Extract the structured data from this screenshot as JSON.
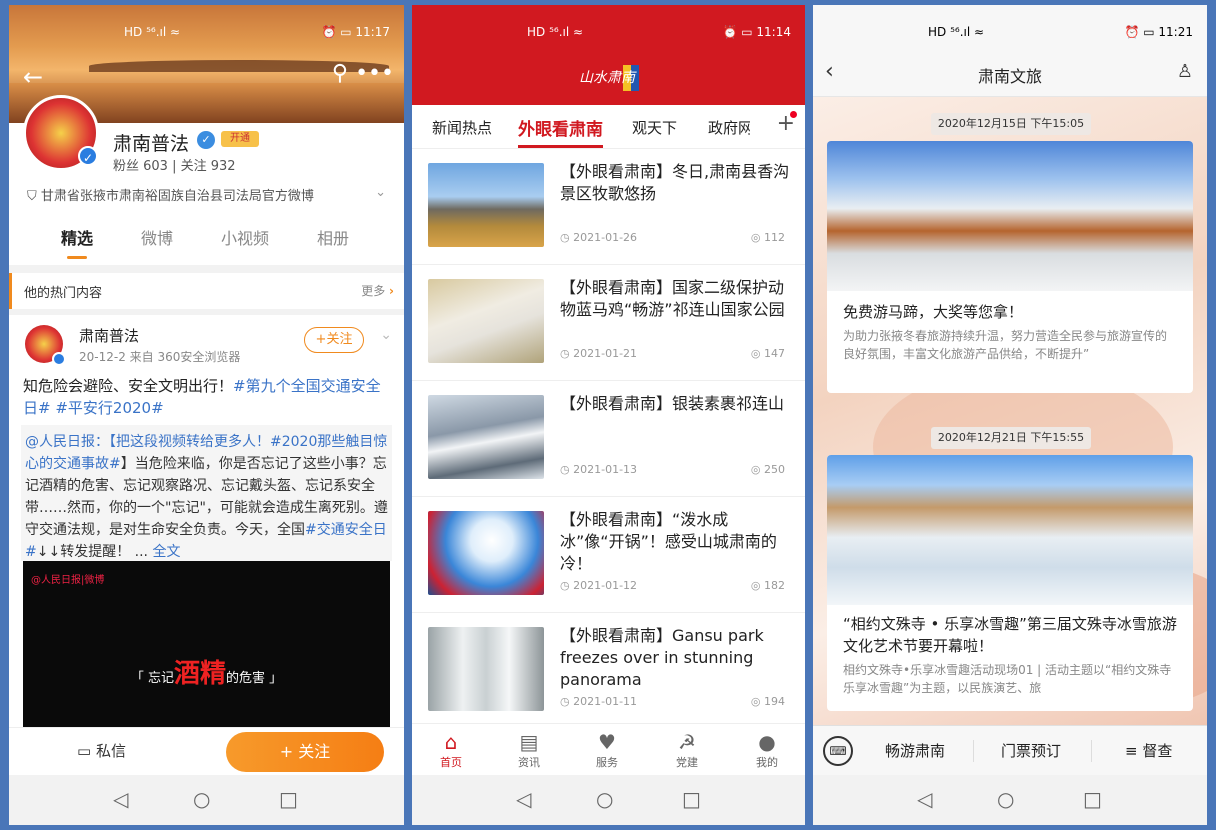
{
  "left_phone": {
    "status": {
      "signal": "HD ⁵⁶.ıl ≈",
      "right": "⏰ ▭ 11:17"
    },
    "profile": {
      "name": "肃南普法",
      "vip": "开通",
      "stats": "粉丝 603 | 关注 932",
      "desc": "甘肃省张掖市肃南裕固族自治县司法局官方微博"
    },
    "tabs": [
      "精选",
      "微博",
      "小视频",
      "相册"
    ],
    "hot": {
      "title": "他的热门内容",
      "more": "更多"
    },
    "post": {
      "author": "肃南普法",
      "meta": "20-12-2  来自 360安全浏览器",
      "follow": "+关注",
      "text_main": "知危险会避险、安全文明出行！",
      "text_tag": "#第九个全国交通安全日# #平安行2020#",
      "repost_prefix": "@人民日报：【把这段视频转给更多人！",
      "repost_tag1": "#2020那些触目惊心的交通事故#",
      "repost_body": "】当危险来临，你是否忘记了这些小事？忘记酒精的危害、忘记观察路况、忘记戴头盔、忘记系安全带……然而，你的一个\"忘记\"，可能就会造成生离死别。遵守交通法规，是对生命安全负责。今天，全国",
      "repost_tag2": "#交通安全日#",
      "repost_tail": "↓↓转发提醒！ ...",
      "repost_full": "全文",
      "video_logo": "@人民日报|微博",
      "video_cap_pre": "「   忘记",
      "video_cap_big": "酒精",
      "video_cap_post": "的危害   」"
    },
    "bottom": {
      "dm": "私信",
      "follow": "+ 关注"
    }
  },
  "mid_phone": {
    "status": {
      "signal": "HD ⁵⁶.ıl ≈",
      "right": "⏰ ▭ 11:14"
    },
    "logo": "山水肃南",
    "tabs": [
      "新闻热点",
      "外眼看肃南",
      "观天下",
      "政府网"
    ],
    "articles": [
      {
        "title": "【外眼看肃南】冬日,肃南县香沟景区牧歌悠扬",
        "date": "2021-01-26",
        "views": "112"
      },
      {
        "title": "【外眼看肃南】国家二级保护动物蓝马鸡“畅游”祁连山国家公园",
        "date": "2021-01-21",
        "views": "147"
      },
      {
        "title": "【外眼看肃南】银装素裹祁连山",
        "date": "2021-01-13",
        "views": "250"
      },
      {
        "title": "【外眼看肃南】“泼水成冰”像“开锅”！感受山城肃南的冷！",
        "date": "2021-01-12",
        "views": "182"
      },
      {
        "title": "【外眼看肃南】Gansu park freezes over in stunning panorama",
        "date": "2021-01-11",
        "views": "194"
      }
    ],
    "tabbar": [
      "首页",
      "资讯",
      "服务",
      "党建",
      "我的"
    ]
  },
  "right_phone": {
    "status": {
      "signal": "HD ⁵⁶.ıl ≈",
      "right": "⏰ ▭ 11:21"
    },
    "title": "肃南文旅",
    "cards": [
      {
        "time": "2020年12月15日 下午15:05",
        "title": "免费游马蹄，大奖等您拿！",
        "desc": "为助力张掖冬春旅游持续升温，努力营造全民参与旅游宣传的良好氛围，丰富文化旅游产品供给，不断提升”"
      },
      {
        "time": "2020年12月21日 下午15:55",
        "title": "“相约文殊寺 • 乐享冰雪趣”第三届文殊寺冰雪旅游文化艺术节要开幕啦！",
        "desc": "相约文殊寺•乐享冰雪趣活动现场01 | 活动主题以“相约文殊寺 乐享冰雪趣”为主题，以民族演艺、旅"
      }
    ],
    "menu": [
      "畅游肃南",
      "门票预订",
      "≡ 督查"
    ]
  }
}
